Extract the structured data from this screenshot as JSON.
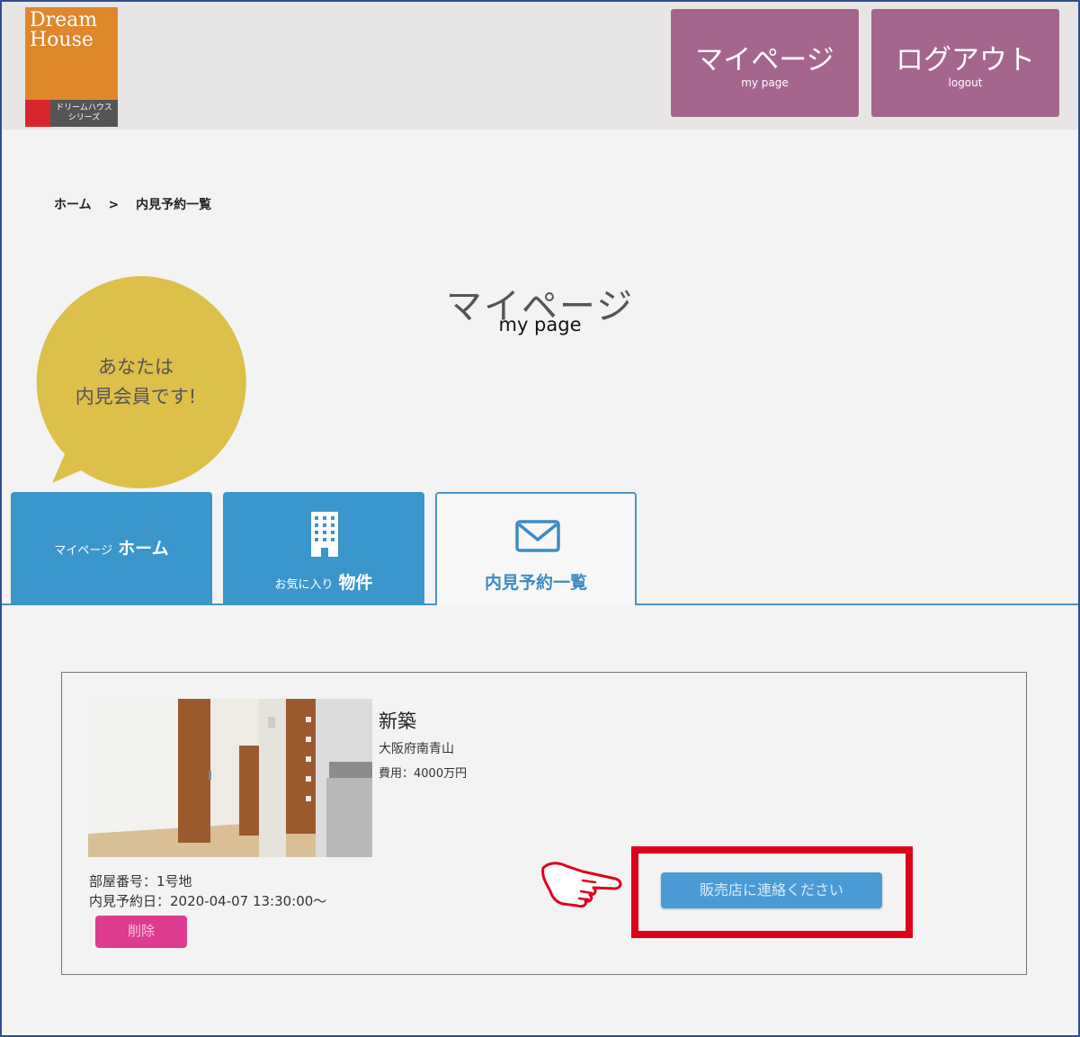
{
  "header": {
    "logo": {
      "line1": "Dream",
      "line2": "House",
      "tag1": "ドリームハウス",
      "tag2": "シリーズ"
    },
    "mypage_button": {
      "label": "マイページ",
      "sub": "my page"
    },
    "logout_button": {
      "label": "ログアウト",
      "sub": "logout"
    }
  },
  "breadcrumb": {
    "home": "ホーム",
    "separator": ">",
    "current": "内見予約一覧"
  },
  "page_title": {
    "jp": "マイページ",
    "en": "my page"
  },
  "badge": {
    "line1": "あなたは",
    "line2": "内見会員です!"
  },
  "tabs": [
    {
      "small": "マイページ",
      "label": "ホーム",
      "active": false
    },
    {
      "small": "お気に入り",
      "label": "物件",
      "active": false
    },
    {
      "small": "",
      "label": "内見予約一覧",
      "active": true
    }
  ],
  "reservation": {
    "title": "新築",
    "address": "大阪府南青山",
    "cost": "費用：4000万円",
    "room": "部屋番号：1号地",
    "visit_date": "内見予約日：2020-04-07 13:30:00〜",
    "delete_label": "削除",
    "contact_label": "販売店に連絡ください"
  },
  "colors": {
    "header_button": "#a5668e",
    "tab_blue": "#3b96cc",
    "badge_yellow": "#dcc04a",
    "delete_pink": "#dc3b8e",
    "highlight_red": "#e0001a"
  }
}
